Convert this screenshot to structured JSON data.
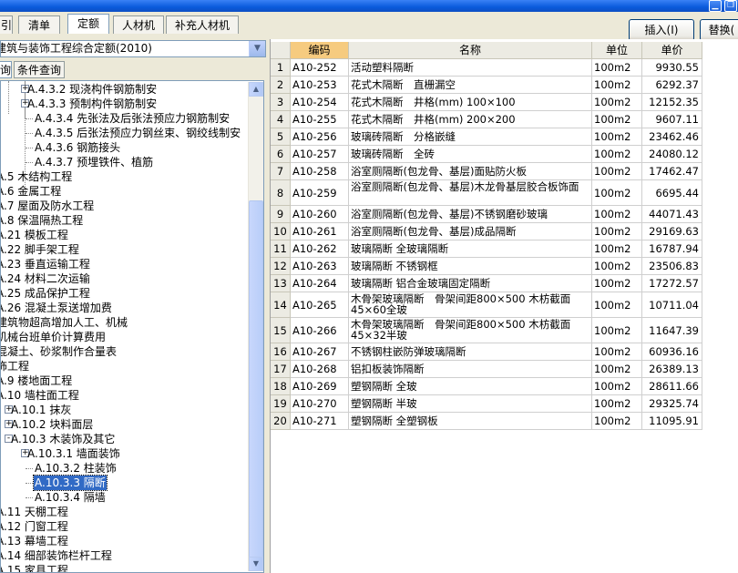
{
  "tabs": [
    "引",
    "清单",
    "定额",
    "人材机",
    "补充人材机"
  ],
  "actions": {
    "insert_label": "插入(I)",
    "replace_label": "替换("
  },
  "left": {
    "combo_value": "建筑与装饰工程综合定额(2010)",
    "subtabs": [
      "询",
      "条件查询"
    ],
    "tree": [
      {
        "label": "A.4.3.2 现浇构件钢筋制安",
        "exp": "+"
      },
      {
        "label": "A.4.3.3 预制构件钢筋制安",
        "exp": "+"
      },
      {
        "label": "A.4.3.4 先张法及后张法预应力钢筋制安",
        "exp": ""
      },
      {
        "label": "A.4.3.5 后张法预应力钢丝束、钢绞线制安",
        "exp": ""
      },
      {
        "label": "A.4.3.6 钢筋接头",
        "exp": ""
      },
      {
        "label": "A.4.3.7 预埋铁件、植筋",
        "exp": ""
      },
      {
        "label": "A.5 木结构工程",
        "exp": ""
      },
      {
        "label": "A.6 金属工程",
        "exp": ""
      },
      {
        "label": "A.7 屋面及防水工程",
        "exp": ""
      },
      {
        "label": "A.8 保温隔热工程",
        "exp": ""
      },
      {
        "label": "A.21 模板工程",
        "exp": ""
      },
      {
        "label": "A.22 脚手架工程",
        "exp": ""
      },
      {
        "label": "A.23 垂直运输工程",
        "exp": ""
      },
      {
        "label": "A.24 材料二次运输",
        "exp": ""
      },
      {
        "label": "A.25 成品保护工程",
        "exp": ""
      },
      {
        "label": "A.26 混凝土泵送增加费",
        "exp": ""
      },
      {
        "label": "建筑物超高增加人工、机械",
        "exp": ""
      },
      {
        "label": "机械台班单价计算费用",
        "exp": ""
      },
      {
        "label": "混凝土、砂浆制作合量表",
        "exp": ""
      },
      {
        "label": "饰工程",
        "exp": ""
      },
      {
        "label": "A.9 楼地面工程",
        "exp": ""
      },
      {
        "label": "A.10 墙柱面工程",
        "exp": ""
      },
      {
        "label": "A.10.1 抹灰",
        "exp": "+"
      },
      {
        "label": "A.10.2 块料面层",
        "exp": "+"
      },
      {
        "label": "A.10.3 木装饰及其它",
        "exp": "-"
      },
      {
        "label": "A.10.3.1 墙面装饰",
        "exp": "+"
      },
      {
        "label": "A.10.3.2 柱装饰",
        "exp": ""
      },
      {
        "label": "A.10.3.3 隔断",
        "exp": ""
      },
      {
        "label": "A.10.3.4 隔墙",
        "exp": ""
      },
      {
        "label": "A.11 天棚工程",
        "exp": ""
      },
      {
        "label": "A.12 门窗工程",
        "exp": ""
      },
      {
        "label": "A.13 幕墙工程",
        "exp": ""
      },
      {
        "label": "A.14 细部装饰栏杆工程",
        "exp": ""
      },
      {
        "label": "A.15 家具工程",
        "exp": ""
      }
    ]
  },
  "grid": {
    "headers": [
      "编码",
      "名称",
      "单位",
      "单价"
    ],
    "rows": [
      {
        "no": "1",
        "code": "A10-252",
        "name": "活动塑料隔断",
        "unit": "100m2",
        "price": "9930.55"
      },
      {
        "no": "2",
        "code": "A10-253",
        "name": "花式木隔断　直栅漏空",
        "unit": "100m2",
        "price": "6292.37"
      },
      {
        "no": "3",
        "code": "A10-254",
        "name": "花式木隔断　井格(mm) 100×100",
        "unit": "100m2",
        "price": "12152.35"
      },
      {
        "no": "4",
        "code": "A10-255",
        "name": "花式木隔断　井格(mm) 200×200",
        "unit": "100m2",
        "price": "9607.11"
      },
      {
        "no": "5",
        "code": "A10-256",
        "name": "玻璃砖隔断　分格嵌缝",
        "unit": "100m2",
        "price": "23462.46"
      },
      {
        "no": "6",
        "code": "A10-257",
        "name": "玻璃砖隔断　全砖",
        "unit": "100m2",
        "price": "24080.12"
      },
      {
        "no": "7",
        "code": "A10-258",
        "name": "浴室厕隔断(包龙骨、基层)面贴防火板",
        "unit": "100m2",
        "price": "17462.47"
      },
      {
        "no": "8",
        "code": "A10-259",
        "name": "浴室厕隔断(包龙骨、基层)木龙骨基层胶合板饰面",
        "unit": "100m2",
        "price": "6695.44"
      },
      {
        "no": "9",
        "code": "A10-260",
        "name": "浴室厕隔断(包龙骨、基层)不锈钢磨砂玻璃",
        "unit": "100m2",
        "price": "44071.43"
      },
      {
        "no": "10",
        "code": "A10-261",
        "name": "浴室厕隔断(包龙骨、基层)成品隔断",
        "unit": "100m2",
        "price": "29169.63"
      },
      {
        "no": "11",
        "code": "A10-262",
        "name": "玻璃隔断 全玻璃隔断",
        "unit": "100m2",
        "price": "16787.94"
      },
      {
        "no": "12",
        "code": "A10-263",
        "name": "玻璃隔断 不锈钢框",
        "unit": "100m2",
        "price": "23506.83"
      },
      {
        "no": "13",
        "code": "A10-264",
        "name": "玻璃隔断 铝合金玻璃固定隔断",
        "unit": "100m2",
        "price": "17272.57"
      },
      {
        "no": "14",
        "code": "A10-265",
        "name": "木骨架玻璃隔断　骨架间距800×500 木枋截面45×60全玻",
        "unit": "100m2",
        "price": "10711.04"
      },
      {
        "no": "15",
        "code": "A10-266",
        "name": "木骨架玻璃隔断　骨架间距800×500 木枋截面45×32半玻",
        "unit": "100m2",
        "price": "11647.39"
      },
      {
        "no": "16",
        "code": "A10-267",
        "name": "不锈钢柱嵌防弹玻璃隔断",
        "unit": "100m2",
        "price": "60936.16"
      },
      {
        "no": "17",
        "code": "A10-268",
        "name": "铝扣板装饰隔断",
        "unit": "100m2",
        "price": "26389.13"
      },
      {
        "no": "18",
        "code": "A10-269",
        "name": "塑钢隔断 全玻",
        "unit": "100m2",
        "price": "28611.66"
      },
      {
        "no": "19",
        "code": "A10-270",
        "name": "塑钢隔断 半玻",
        "unit": "100m2",
        "price": "29325.74"
      },
      {
        "no": "20",
        "code": "A10-271",
        "name": "塑钢隔断 全塑钢板",
        "unit": "100m2",
        "price": "11095.91"
      }
    ]
  }
}
